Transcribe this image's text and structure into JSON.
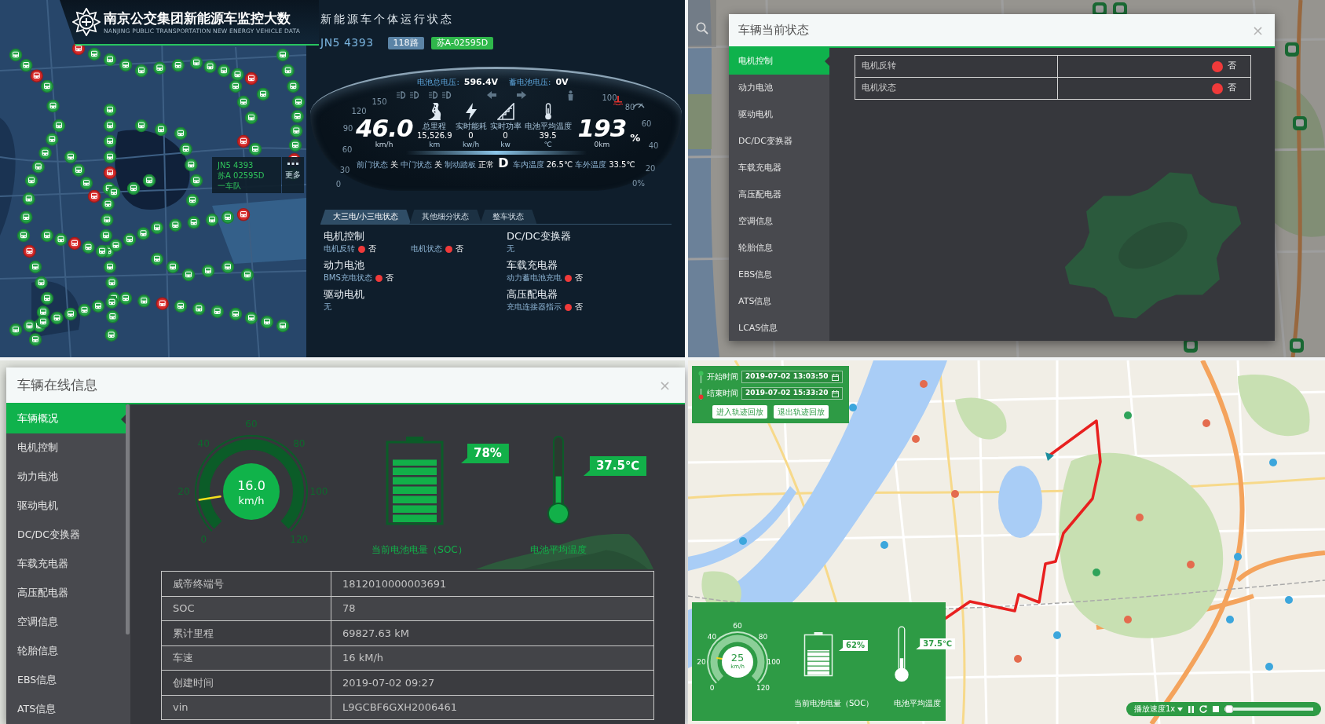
{
  "monitor_map": {
    "header": {
      "title": "南京公交集团新能源车监控大数",
      "subtitle": "NANJING PUBLIC TRANSPORTATION NEW ENERGY VEHICLE DATA"
    },
    "tooltip": {
      "lines": [
        "JN5 4393",
        "苏A 02595D",
        "一车队"
      ],
      "more": "更多"
    }
  },
  "vehicle_status": {
    "title": "新能源车个体运行状态",
    "vehicle_no": "JN5 4393",
    "tags": [
      {
        "text": "118路",
        "color": "#5b84a6"
      },
      {
        "text": "苏A-02595D",
        "color": "#2fb84b"
      }
    ],
    "cluster": {
      "readings": [
        {
          "label": "电池总电压:",
          "value": "596.4V"
        },
        {
          "label": "蓄电池电压:",
          "value": "0V"
        }
      ],
      "left_scale": [
        "150",
        "120",
        "90",
        "60",
        "30",
        "0"
      ],
      "right_scale": [
        "100",
        "80",
        "60",
        "40",
        "20",
        "0%"
      ],
      "speed": {
        "value": "46.0",
        "unit": "km/h"
      },
      "metrics": [
        {
          "kind": "road",
          "label": "总里程",
          "value": "15,526.9",
          "unit": "km"
        },
        {
          "kind": "bolt",
          "label": "实时能耗",
          "value": "0",
          "unit": "kw/h"
        },
        {
          "kind": "slope",
          "label": "实时功率",
          "value": "0",
          "unit": "kw"
        },
        {
          "kind": "thermometer",
          "label": "电池平均温度",
          "value": "39.5",
          "unit": "℃"
        }
      ],
      "range": {
        "value": "193",
        "unit": "0km",
        "suffix": "%"
      },
      "states": [
        {
          "label": "前门状态",
          "value": "关"
        },
        {
          "label": "中门状态",
          "value": "关"
        },
        {
          "label": "制动踏板",
          "value": "正常"
        }
      ],
      "gear": "D",
      "temperatures": [
        {
          "label": "车内温度",
          "value": "26.5℃"
        },
        {
          "label": "车外温度",
          "value": "33.5℃"
        }
      ]
    },
    "tabs": [
      {
        "label": "大三电/小三电状态",
        "selected": true
      },
      {
        "label": "其他细分状态",
        "selected": false
      },
      {
        "label": "整车状态",
        "selected": false
      }
    ],
    "columns": [
      [
        {
          "title": "电机控制",
          "items": [
            {
              "label": "电机反转",
              "value": "否",
              "color": "#f03a3a"
            },
            {
              "label": "电机状态",
              "value": "否",
              "color": "#f03a3a"
            }
          ]
        },
        {
          "title": "动力电池",
          "items": [
            {
              "label": "BMS充电状态",
              "value": "否",
              "color": "#f03a3a"
            }
          ]
        },
        {
          "title": "驱动电机",
          "note": "无"
        }
      ],
      [
        {
          "title": "DC/DC变换器",
          "note": "无"
        },
        {
          "title": "车载充电器",
          "items": [
            {
              "label": "动力蓄电池充电",
              "value": "否",
              "color": "#f03a3a"
            }
          ]
        },
        {
          "title": "高压配电器",
          "items": [
            {
              "label": "充电连接器指示",
              "value": "否",
              "color": "#f03a3a"
            }
          ]
        }
      ]
    ]
  },
  "current_status": {
    "title": "车辆当前状态",
    "close": "×",
    "menu": [
      {
        "label": "电机控制",
        "selected": true
      },
      {
        "label": "动力电池",
        "selected": false
      },
      {
        "label": "驱动电机",
        "selected": false
      },
      {
        "label": "DC/DC变换器",
        "selected": false
      },
      {
        "label": "车载充电器",
        "selected": false
      },
      {
        "label": "高压配电器",
        "selected": false
      },
      {
        "label": "空调信息",
        "selected": false
      },
      {
        "label": "轮胎信息",
        "selected": false
      },
      {
        "label": "EBS信息",
        "selected": false
      },
      {
        "label": "ATS信息",
        "selected": false
      },
      {
        "label": "LCAS信息",
        "selected": false
      }
    ],
    "rows": [
      {
        "label": "电机反转",
        "value": "否",
        "color": "#f03a3a"
      },
      {
        "label": "电机状态",
        "value": "否",
        "color": "#f03a3a"
      }
    ]
  },
  "online_info": {
    "title": "车辆在线信息",
    "close": "×",
    "menu": [
      {
        "label": "车辆概况",
        "selected": true
      },
      {
        "label": "电机控制",
        "selected": false
      },
      {
        "label": "动力电池",
        "selected": false
      },
      {
        "label": "驱动电机",
        "selected": false
      },
      {
        "label": "DC/DC变换器",
        "selected": false
      },
      {
        "label": "车载充电器",
        "selected": false
      },
      {
        "label": "高压配电器",
        "selected": false
      },
      {
        "label": "空调信息",
        "selected": false
      },
      {
        "label": "轮胎信息",
        "selected": false
      },
      {
        "label": "EBS信息",
        "selected": false
      },
      {
        "label": "ATS信息",
        "selected": false
      }
    ],
    "speed_gauge": {
      "ticks": [
        "0",
        "20",
        "40",
        "60",
        "80",
        "100",
        "120"
      ],
      "value": "16.0",
      "unit": "km/h",
      "level": 0.133
    },
    "battery": {
      "reading": "78%",
      "caption": "当前电池电量（SOC）",
      "level": 0.78
    },
    "thermometer": {
      "reading": "37.5℃",
      "caption": "电池平均温度",
      "level": 0.45
    },
    "table": [
      {
        "label": "威帝终端号",
        "value": "1812010000003691"
      },
      {
        "label": "SOC",
        "value": "78"
      },
      {
        "label": "累计里程",
        "value": "69827.63 kM"
      },
      {
        "label": "车速",
        "value": "16 kM/h"
      },
      {
        "label": "创建时间",
        "value": "2019-07-02 09:27"
      },
      {
        "label": "vin",
        "value": "L9GCBF6GXH2006461"
      }
    ]
  },
  "track_playback": {
    "times": [
      {
        "label": "开始时间",
        "value": "2019-07-02 13:03:50",
        "color": "#3ec35a"
      },
      {
        "label": "结束时间",
        "value": "2019-07-02 15:33:20",
        "color": "#e8322f"
      }
    ],
    "buttons": [
      "进入轨迹回放",
      "退出轨迹回放"
    ],
    "stats": {
      "speed_gauge": {
        "ticks": [
          "0",
          "20",
          "40",
          "60",
          "80",
          "100",
          "120"
        ],
        "value": "25",
        "unit": "km/h",
        "level": 0.208
      },
      "battery": {
        "reading": "62%",
        "caption": "当前电池电量（SOC）",
        "level": 0.62
      },
      "thermometer": {
        "reading": "37.5℃",
        "caption": "电池平均温度",
        "level": 0.3
      }
    },
    "player": {
      "speed": "播放速度1x",
      "level": 0.05
    }
  }
}
